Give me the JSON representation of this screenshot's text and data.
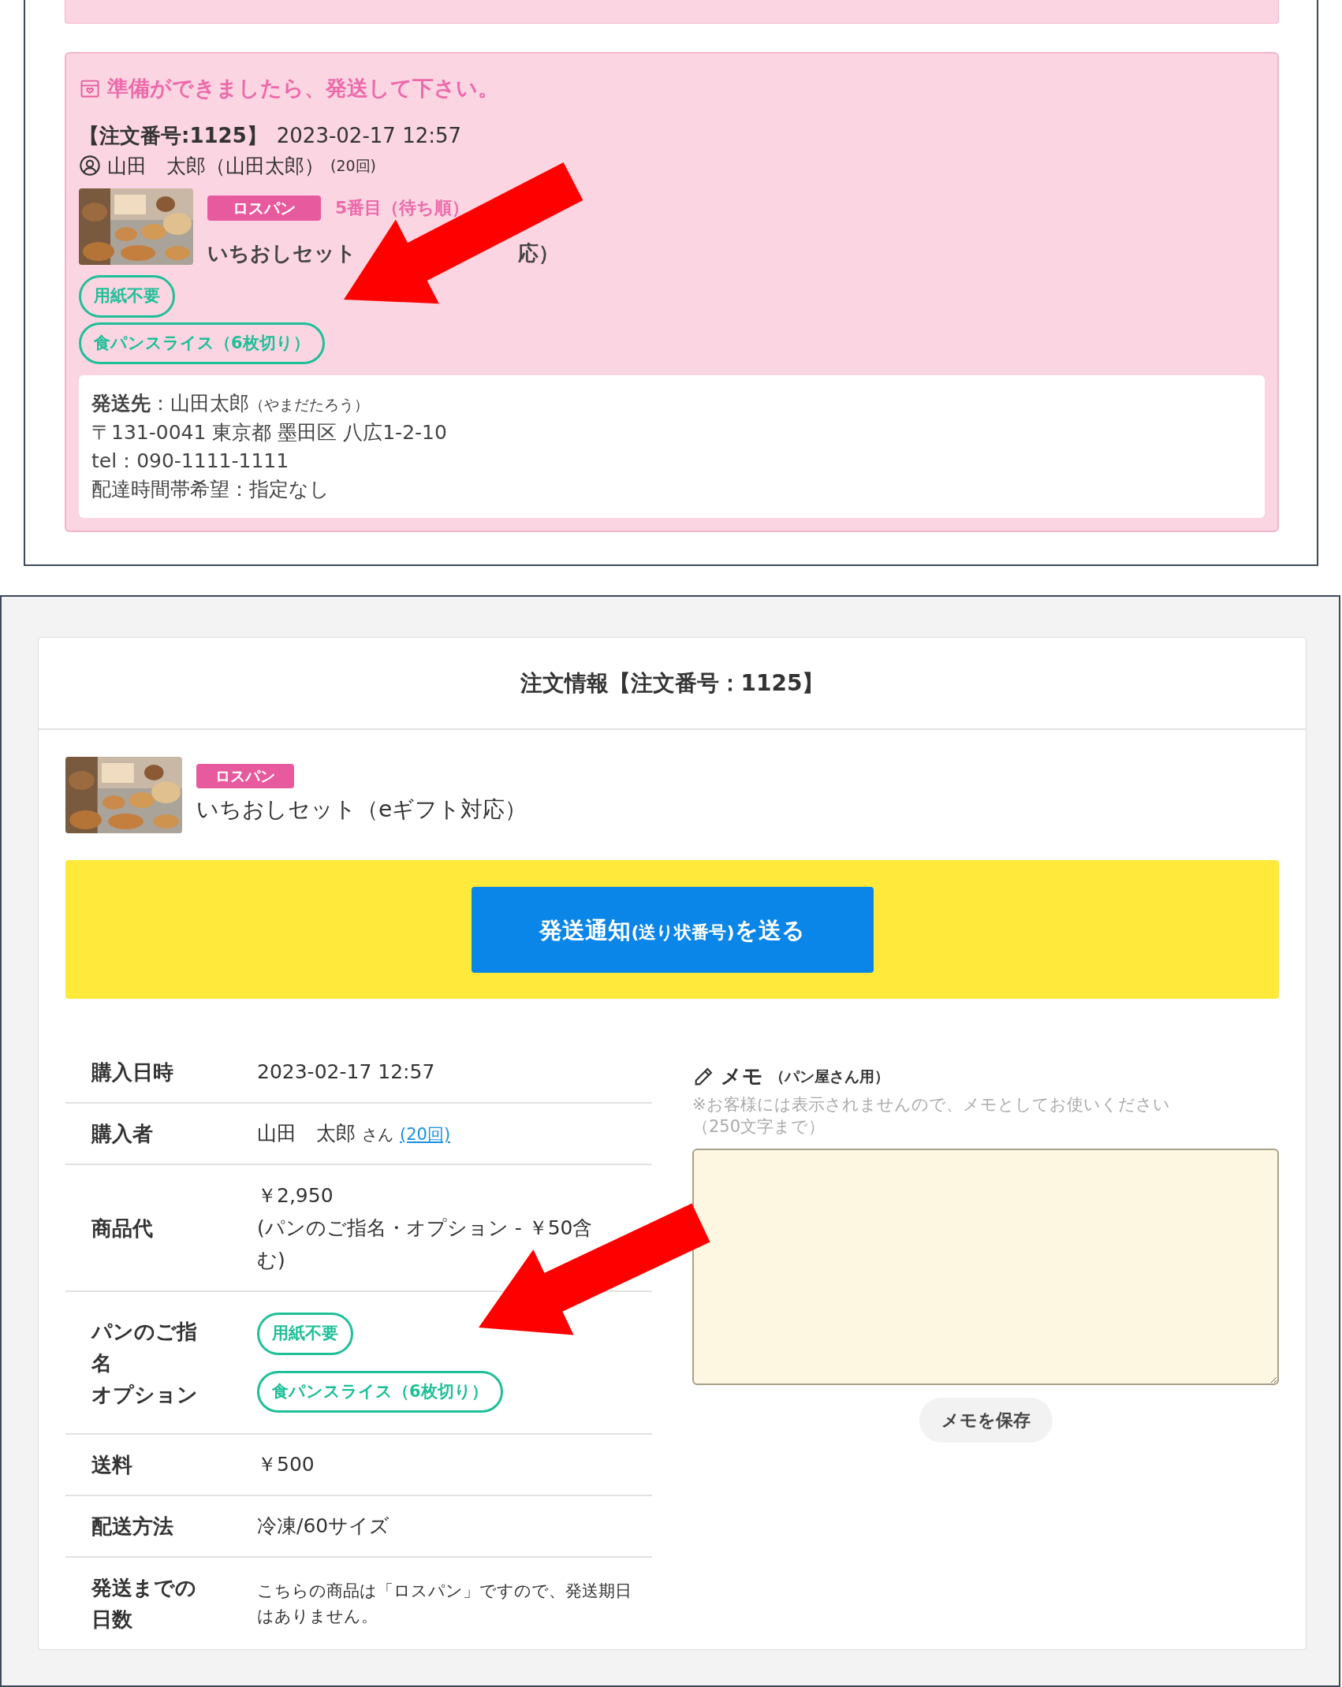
{
  "shipping_card": {
    "heading": "準備ができましたら、発送して下さい。",
    "order_number": "【注文番号:1125】",
    "date": "2023-02-17 12:57",
    "customer": "山田　太郎（山田太郎）",
    "count": "(20回)",
    "badge": "ロスパン",
    "queue": "5番目（待ち順）",
    "product_name_parts": [
      "いちおしセット",
      "応）"
    ],
    "options": [
      "用紙不要",
      "食パンスライス（6枚切り）"
    ],
    "address": {
      "label": "発送先",
      "name": "：山田太郎",
      "kana": "（やまだたろう）",
      "lines": [
        "〒131-0041 東京都 墨田区 八広1-2-10",
        "tel：090-1111-1111",
        "配達時間帯希望：指定なし"
      ]
    }
  },
  "order_info": {
    "title": "注文情報【注文番号：1125】",
    "badge": "ロスパン",
    "product_name": "いちおしセット（eギフト対応）",
    "send_button": [
      {
        "text": "発送通知",
        "small": false
      },
      {
        "text": "(送り状番号)",
        "small": true
      },
      {
        "text": "を送る",
        "small": false
      }
    ],
    "rows": [
      {
        "kind": "text",
        "label": "購入日時",
        "value": "2023-02-17 12:57"
      },
      {
        "kind": "buyer",
        "label": "購入者",
        "value": "山田　太郎",
        "suffix": "さん",
        "link": "(20回)"
      },
      {
        "kind": "lines",
        "label": "商品代",
        "lines": [
          "￥2,950",
          "(パンのご指名・オプション - ￥50含",
          "む)"
        ]
      },
      {
        "kind": "pills",
        "label_lines": [
          "パンのご指名",
          "オプション"
        ],
        "pills": [
          "用紙不要",
          "食パンスライス（6枚切り）"
        ]
      },
      {
        "kind": "text",
        "label": "送料",
        "value": "￥500"
      },
      {
        "kind": "text",
        "label": "配送方法",
        "value": "冷凍/60サイズ"
      },
      {
        "kind": "note",
        "label": "発送までの日数",
        "value": "こちらの商品は「ロスパン」ですので、発送期日はありません。"
      }
    ],
    "memo": {
      "title": "メモ",
      "subtitle": "（パン屋さん用）",
      "note_lines": [
        "※お客様には表示されませんので、メモとしてお使いください",
        "（250文字まで）"
      ],
      "button": "メモを保存"
    }
  }
}
